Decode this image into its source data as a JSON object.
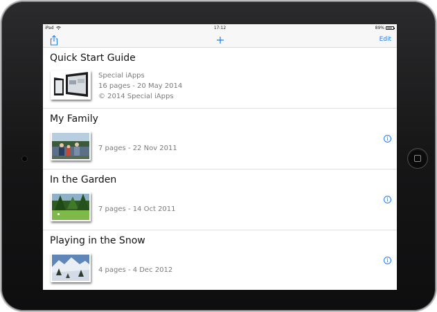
{
  "status_bar": {
    "device": "iPad",
    "time": "17:12",
    "battery": "89%",
    "battery_level": 0.89
  },
  "toolbar": {
    "edit_label": "Edit"
  },
  "books": [
    {
      "title": "Quick Start Guide",
      "publisher": "Special iApps",
      "details": "16 pages - 20 May 2014",
      "copyright": "© 2014 Special iApps"
    },
    {
      "title": "My Family",
      "details": "7 pages - 22 Nov 2011",
      "info_icon": "i"
    },
    {
      "title": "In the Garden",
      "details": "7 pages - 14 Oct 2011",
      "info_icon": "i"
    },
    {
      "title": "Playing in the Snow",
      "details": "4 pages - 4 Dec 2012",
      "info_icon": "i"
    }
  ],
  "colors": {
    "accent": "#1a7cf4",
    "meta_text": "#7a7a7a",
    "bar_bg": "#f7f7f7"
  }
}
